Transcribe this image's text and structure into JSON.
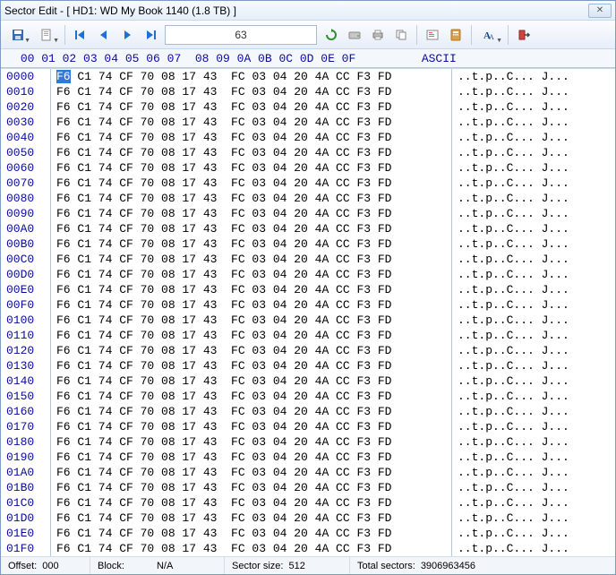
{
  "window": {
    "title": "Sector Edit - [ HD1: WD My Book 1140 (1.8 TB) ]"
  },
  "toolbar": {
    "sector_value": "63"
  },
  "header": {
    "hex_cols": "00 01 02 03 04 05 06 07  08 09 0A 0B 0C 0D 0E 0F",
    "ascii_label": "ASCII"
  },
  "hex": {
    "first_byte": "F6",
    "rest_first_row": " C1 74 CF 70 08 17 43  FC 03 04 20 4A CC F3 FD",
    "row_template": "F6 C1 74 CF 70 08 17 43  FC 03 04 20 4A CC F3 FD",
    "ascii_template": "..t.p..C... J...",
    "addresses": [
      "0000",
      "0010",
      "0020",
      "0030",
      "0040",
      "0050",
      "0060",
      "0070",
      "0080",
      "0090",
      "00A0",
      "00B0",
      "00C0",
      "00D0",
      "00E0",
      "00F0",
      "0100",
      "0110",
      "0120",
      "0130",
      "0140",
      "0150",
      "0160",
      "0170",
      "0180",
      "0190",
      "01A0",
      "01B0",
      "01C0",
      "01D0",
      "01E0",
      "01F0"
    ]
  },
  "status": {
    "offset_label": "Offset:",
    "offset_value": "000",
    "block_label": "Block:",
    "block_value": "N/A",
    "ssize_label": "Sector size:",
    "ssize_value": "512",
    "total_label": "Total sectors:",
    "total_value": "3906963456"
  }
}
